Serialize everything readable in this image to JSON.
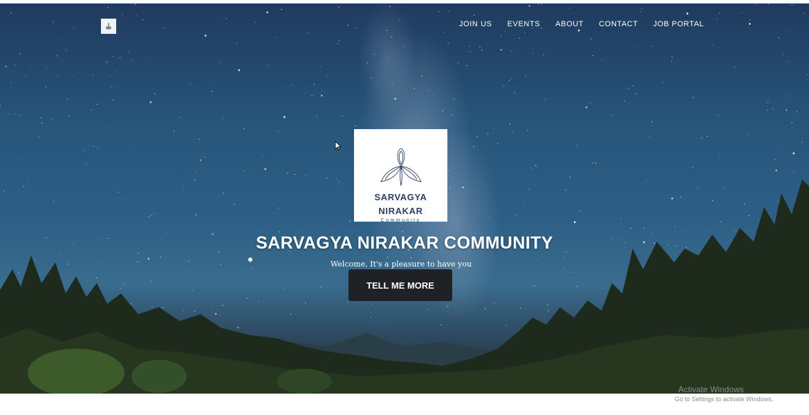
{
  "nav": {
    "logo": "logo-icon",
    "items": [
      {
        "label": "JOIN US"
      },
      {
        "label": "EVENTS"
      },
      {
        "label": "ABOUT"
      },
      {
        "label": "CONTACT"
      },
      {
        "label": "JOB PORTAL"
      }
    ]
  },
  "hero": {
    "logo_card": {
      "line1": "SARVAGYA",
      "line2": "NIRAKAR",
      "line3": "Community",
      "icon": "leaf-emblem-icon"
    },
    "title": "SARVAGYA NIRAKAR COMMUNITY",
    "subtitle": "Welcome, It's a pleasure to have you",
    "cta_label": "TELL ME MORE"
  },
  "os_watermark": {
    "title": "Activate Windows",
    "subtitle": "Go to Settings to activate Windows."
  },
  "colors": {
    "cta_bg": "#202124",
    "logo_text": "#2c3e63",
    "sky_top": "#1f3b5e",
    "sky_mid": "#2d5f86"
  }
}
